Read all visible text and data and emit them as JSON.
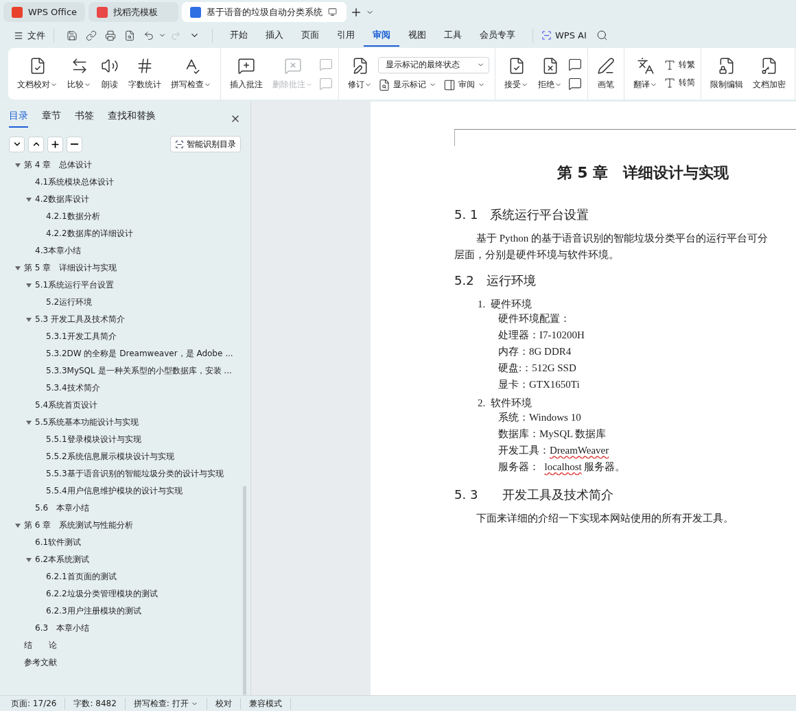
{
  "browser_tabs": [
    {
      "label": "WPS Office",
      "selected": false
    },
    {
      "label": "找稻壳模板",
      "selected": false
    },
    {
      "label": "基于语音的垃圾自动分类系统",
      "selected": true
    }
  ],
  "menu": {
    "file": "文件",
    "tabs": [
      {
        "label": "开始",
        "selected": false
      },
      {
        "label": "插入",
        "selected": false
      },
      {
        "label": "页面",
        "selected": false
      },
      {
        "label": "引用",
        "selected": false
      },
      {
        "label": "审阅",
        "selected": true
      },
      {
        "label": "视图",
        "selected": false
      },
      {
        "label": "工具",
        "selected": false
      },
      {
        "label": "会员专享",
        "selected": false
      }
    ],
    "ai": "WPS AI"
  },
  "ribbon": [
    {
      "items": [
        {
          "kind": "large",
          "label": "文档校对",
          "dropdown": true,
          "disabled": false
        },
        {
          "kind": "large",
          "label": "比较",
          "dropdown": true,
          "disabled": false
        },
        {
          "kind": "large",
          "label": "朗读",
          "dropdown": false,
          "disabled": false
        },
        {
          "kind": "large",
          "label": "字数统计",
          "dropdown": false,
          "disabled": false
        },
        {
          "kind": "large",
          "label": "拼写检查",
          "dropdown": true,
          "disabled": false
        }
      ]
    },
    {
      "items": [
        {
          "kind": "large",
          "label": "插入批注",
          "dropdown": false,
          "disabled": false
        },
        {
          "kind": "large",
          "label": "删除批注",
          "dropdown": true,
          "disabled": true
        },
        {
          "kind": "stack",
          "rows": [
            [
              {
                "kind": "icon",
                "disabled": true
              }
            ],
            [
              {
                "kind": "icon",
                "disabled": true
              }
            ]
          ]
        }
      ]
    },
    {
      "items": [
        {
          "kind": "large",
          "label": "修订",
          "dropdown": true,
          "disabled": false
        },
        {
          "kind": "stack",
          "rows": [
            [
              {
                "kind": "select",
                "value": "显示标记的最终状态"
              }
            ],
            [
              {
                "kind": "small",
                "label": "显示标记",
                "dropdown": true,
                "disabled": false
              },
              {
                "kind": "small",
                "label": "审阅",
                "dropdown": true,
                "disabled": false
              }
            ]
          ]
        }
      ]
    },
    {
      "items": [
        {
          "kind": "large",
          "label": "接受",
          "dropdown": true,
          "disabled": false
        },
        {
          "kind": "large",
          "label": "拒绝",
          "dropdown": true,
          "disabled": false
        },
        {
          "kind": "stack",
          "rows": [
            [
              {
                "kind": "icon",
                "disabled": false
              }
            ],
            [
              {
                "kind": "icon",
                "disabled": false
              }
            ]
          ]
        }
      ]
    },
    {
      "items": [
        {
          "kind": "large",
          "label": "画笔",
          "dropdown": false,
          "disabled": false
        }
      ]
    },
    {
      "items": [
        {
          "kind": "large",
          "label": "翻译",
          "dropdown": true,
          "disabled": false
        },
        {
          "kind": "stack",
          "rows": [
            [
              {
                "kind": "small",
                "label": "转繁",
                "dropdown": false,
                "disabled": false
              }
            ],
            [
              {
                "kind": "small",
                "label": "转简",
                "dropdown": false,
                "disabled": false
              }
            ]
          ]
        }
      ]
    },
    {
      "items": [
        {
          "kind": "large",
          "label": "限制编辑",
          "dropdown": false,
          "disabled": false
        },
        {
          "kind": "large",
          "label": "文档加密",
          "dropdown": false,
          "disabled": false
        }
      ]
    }
  ],
  "sidebar": {
    "tabs": [
      {
        "label": "目录",
        "selected": true
      },
      {
        "label": "章节",
        "selected": false
      },
      {
        "label": "书签",
        "selected": false
      },
      {
        "label": "查找和替换",
        "selected": false
      }
    ],
    "smart_button": "智能识别目录",
    "toc": [
      {
        "text": "第 4 章　总体设计",
        "expanded": true,
        "children": [
          {
            "text": "4.1系统模块总体设计"
          },
          {
            "text": "4.2数据库设计",
            "expanded": true,
            "children": [
              {
                "text": "4.2.1数据分析"
              },
              {
                "text": "4.2.2数据库的详细设计"
              }
            ]
          },
          {
            "text": "4.3本章小结"
          }
        ]
      },
      {
        "text": "第 5 章　详细设计与实现",
        "expanded": true,
        "children": [
          {
            "text": "5.1系统运行平台设置",
            "expanded": true,
            "children": [
              {
                "text": "5.2运行环境"
              }
            ]
          },
          {
            "text": "5.3  开发工具及技术简介",
            "expanded": true,
            "children": [
              {
                "text": "5.3.1开发工具简介"
              },
              {
                "text": "5.3.2DW 的全称是 Dreamweaver，是 Adobe ..."
              },
              {
                "text": "5.3.3MySQL 是一种关系型的小型数据库，安装 ..."
              },
              {
                "text": "5.3.4技术简介"
              }
            ]
          },
          {
            "text": "5.4系统首页设计"
          },
          {
            "text": "5.5系统基本功能设计与实现",
            "expanded": true,
            "children": [
              {
                "text": "5.5.1登录模块设计与实现"
              },
              {
                "text": "5.5.2系统信息展示模块设计与实现"
              },
              {
                "text": "5.5.3基于语音识别的智能垃圾分类的设计与实现"
              },
              {
                "text": "5.5.4用户信息维护模块的设计与实现"
              }
            ]
          },
          {
            "text": "5.6　本章小结"
          }
        ]
      },
      {
        "text": "第 6 章　系统测试与性能分析",
        "expanded": true,
        "children": [
          {
            "text": "6.1软件测试"
          },
          {
            "text": "6.2本系统测试",
            "expanded": true,
            "children": [
              {
                "text": "6.2.1首页面的测试"
              },
              {
                "text": "6.2.2垃圾分类管理模块的测试"
              },
              {
                "text": "6.2.3用户注册模块的测试"
              }
            ]
          },
          {
            "text": "6.3　本章小结"
          }
        ]
      },
      {
        "text": "结　　论"
      },
      {
        "text": "参考文献"
      }
    ]
  },
  "document": [
    {
      "kind": "title",
      "text": "第 5 章　详细设计与实现"
    },
    {
      "kind": "heading",
      "text": "5. 1　系统运行平台设置"
    },
    {
      "kind": "para",
      "lines": [
        "基于 Python 的基于语音识别的智能垃圾分类平台的运行平台可分",
        "层面，分别是硬件环境与软件环境。"
      ]
    },
    {
      "kind": "heading",
      "text": "5.2　运行环境"
    },
    {
      "kind": "list",
      "number": "1.",
      "text": "硬件环境"
    },
    {
      "kind": "line",
      "segments": [
        {
          "text": "硬件环境配置：",
          "misspelled": false
        }
      ]
    },
    {
      "kind": "line",
      "segments": [
        {
          "text": "处理器：I7-10200H",
          "misspelled": false
        }
      ]
    },
    {
      "kind": "line",
      "segments": [
        {
          "text": "内存：8G DDR4",
          "misspelled": false
        }
      ]
    },
    {
      "kind": "line",
      "segments": [
        {
          "text": "硬盘:：512G SSD",
          "misspelled": false
        }
      ]
    },
    {
      "kind": "line",
      "segments": [
        {
          "text": "显卡：GTX1650Ti",
          "misspelled": false
        }
      ]
    },
    {
      "kind": "list",
      "number": "2.",
      "text": "软件环境"
    },
    {
      "kind": "line",
      "segments": [
        {
          "text": "系统：Windows 10",
          "misspelled": false
        }
      ]
    },
    {
      "kind": "line",
      "segments": [
        {
          "text": "数据库：MySQL 数据库",
          "misspelled": false
        }
      ]
    },
    {
      "kind": "line",
      "segments": [
        {
          "text": "开发工具：",
          "misspelled": false
        },
        {
          "text": "DreamWeaver",
          "misspelled": true
        }
      ]
    },
    {
      "kind": "line",
      "segments": [
        {
          "text": "服务器：  ",
          "misspelled": false
        },
        {
          "text": "localhost",
          "misspelled": true
        },
        {
          "text": " 服务器。",
          "misspelled": false
        }
      ]
    },
    {
      "kind": "heading",
      "text": "5. 3　　开发工具及技术简介"
    },
    {
      "kind": "para",
      "lines": [
        "下面来详细的介绍一下实现本网站使用的所有开发工具。"
      ]
    }
  ],
  "status_bar": [
    {
      "kind": "text",
      "text": "页面: 17/26"
    },
    {
      "kind": "text",
      "text": "字数: 8482"
    },
    {
      "kind": "dropdown",
      "text": "拼写检查: 打开"
    },
    {
      "kind": "text",
      "text": "校对"
    },
    {
      "kind": "text",
      "text": "兼容模式"
    }
  ]
}
